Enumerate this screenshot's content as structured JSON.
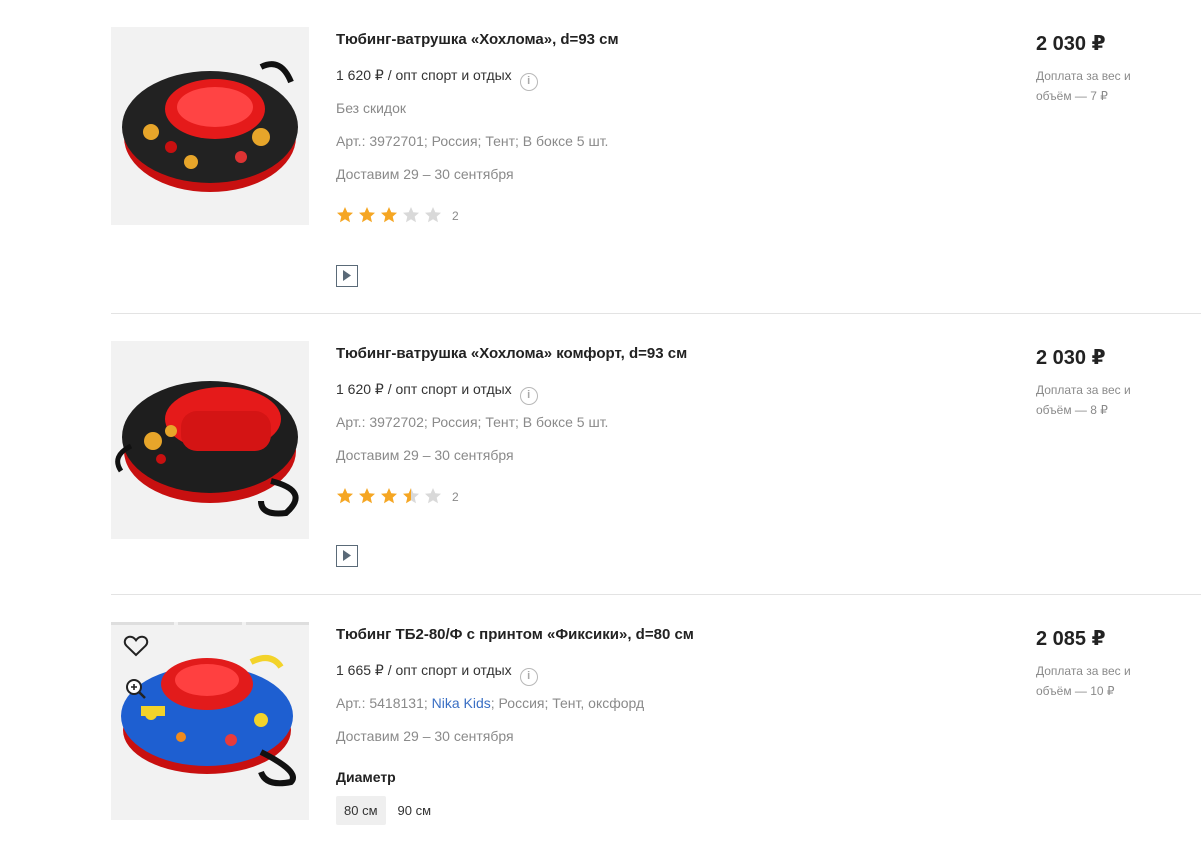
{
  "products": [
    {
      "title": "Тюбинг-ватрушка «Хохлома», d=93 см",
      "wholesale": "1 620 ₽ / опт спорт и отдых",
      "discount": "Без скидок",
      "details": "Арт.: 3972701; Россия; Тент; В боксе 5 шт.",
      "delivery": "Доставим 29 – 30 сентября",
      "rating": 3,
      "rating_count": "2",
      "price": "2 030 ₽",
      "surcharge": "Доплата за вес и объём — 7 ₽"
    },
    {
      "title": "Тюбинг-ватрушка «Хохлома» комфорт, d=93 см",
      "wholesale": "1 620 ₽ / опт спорт и отдых",
      "details": "Арт.: 3972702; Россия; Тент; В боксе 5 шт.",
      "delivery": "Доставим 29 – 30 сентября",
      "rating": 3.5,
      "rating_count": "2",
      "price": "2 030 ₽",
      "surcharge": "Доплата за вес и объём — 8 ₽"
    },
    {
      "title": "Тюбинг ТБ2-80/Ф с принтом «Фиксики», d=80 см",
      "wholesale": "1 665 ₽ / опт спорт и отдых",
      "details_prefix": "Арт.: 5418131;",
      "brand": "Nika Kids",
      "details_suffix": "; Россия; Тент, оксфорд",
      "delivery": "Доставим 29 – 30 сентября",
      "option_label": "Диаметр",
      "options": [
        "80 см",
        "90 см"
      ],
      "selected_option": "80 см",
      "price": "2 085 ₽",
      "surcharge": "Доплата за вес и объём — 10 ₽"
    }
  ],
  "icons": {
    "info": "info-icon",
    "video": "play-video-icon",
    "favorite": "heart-icon",
    "zoom": "zoom-in-icon",
    "star": "star-icon"
  },
  "colors": {
    "star_filled": "#f5a623",
    "star_empty": "#d9d9d9",
    "link": "#3a6fc4",
    "muted_text": "#8a8a8a"
  }
}
